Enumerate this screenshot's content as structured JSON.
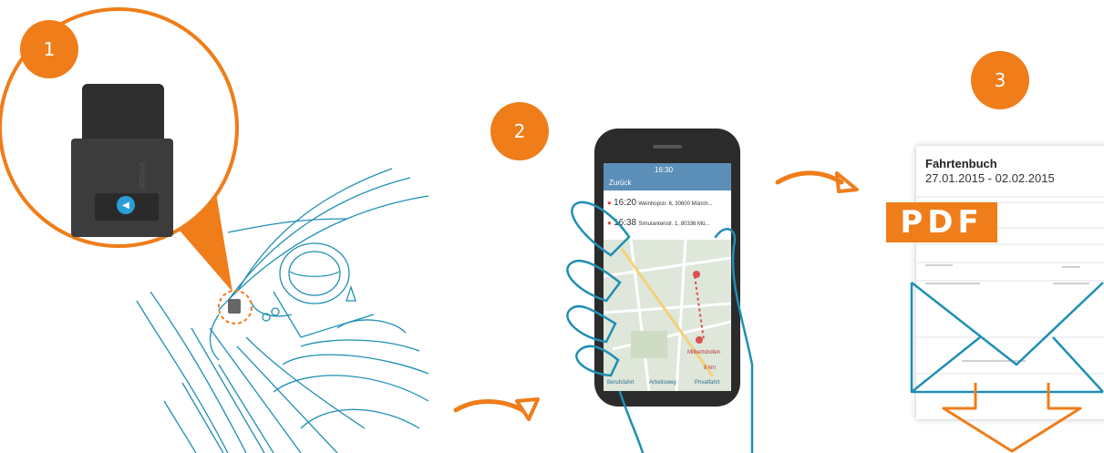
{
  "steps": [
    {
      "number": "1"
    },
    {
      "number": "2"
    },
    {
      "number": "3"
    }
  ],
  "device": {
    "brand": "Vimcar"
  },
  "phone": {
    "back_label": "Zurück",
    "time": "16:30",
    "trips": [
      {
        "time": "16:20",
        "place": "Weinhopstr. 6, 30600 Münch..."
      },
      {
        "time": "16:38",
        "place": "Simulantenstr. 1, 80336 Mü..."
      }
    ],
    "map_label": "Milbertshofen",
    "distance": "8 km",
    "tabs": [
      {
        "label": "Berufsfahrt"
      },
      {
        "label": "Arbeitsweg"
      },
      {
        "label": "Privatfahrt"
      }
    ]
  },
  "logbook": {
    "title": "Fahrtenbuch",
    "date_range": "27.01.2015 - 02.02.2015",
    "format_tag": "PDF"
  },
  "colors": {
    "accent": "#ef7d1a",
    "line": "#1f8fb3",
    "phone": "#2b2b2b",
    "map": "#dfe6da"
  },
  "icons": [
    "arrow-right-icon",
    "envelope-icon",
    "arrow-down-icon",
    "location-pin-icon",
    "hand-icon"
  ]
}
